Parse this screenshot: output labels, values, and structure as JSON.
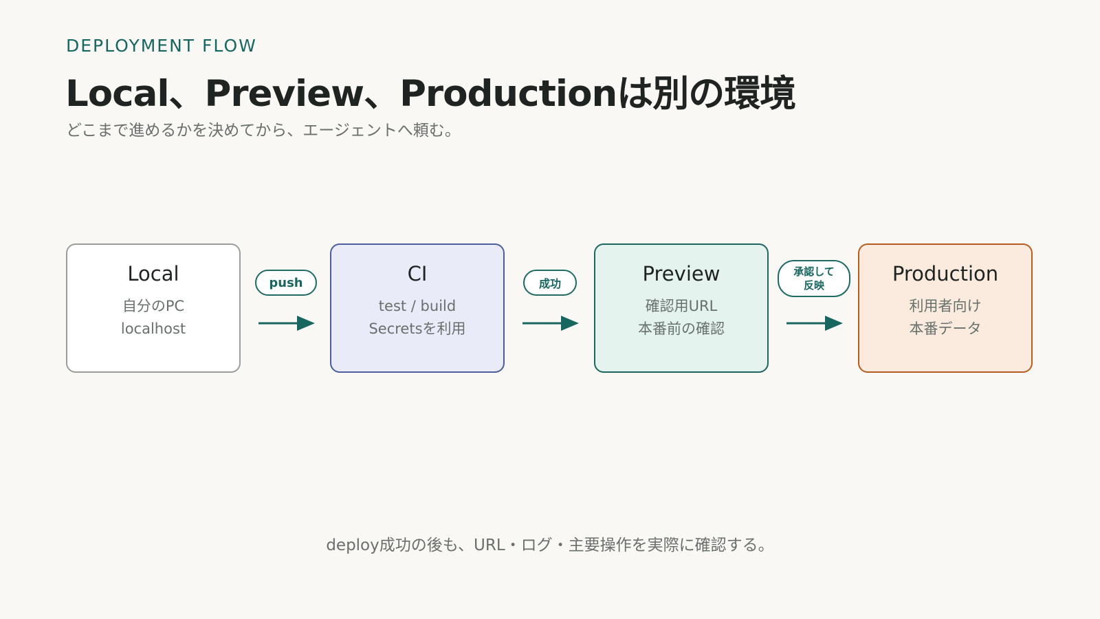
{
  "header": {
    "eyebrow": "DEPLOYMENT FLOW",
    "title": "Local、Preview、Productionは別の環境",
    "subtitle": "どこまで進めるかを決めてから、エージェントへ頼む。"
  },
  "stages": [
    {
      "title": "Local",
      "lines": [
        "自分のPC",
        "localhost"
      ],
      "fill": "#ffffff",
      "border": "#9a9d9b"
    },
    {
      "title": "CI",
      "lines": [
        "test / build",
        "Secretsを利用"
      ],
      "fill": "#e9ebf8",
      "border": "#4b5d9c"
    },
    {
      "title": "Preview",
      "lines": [
        "確認用URL",
        "本番前の確認"
      ],
      "fill": "#e5f3ef",
      "border": "#1e655d"
    },
    {
      "title": "Production",
      "lines": [
        "利用者向け",
        "本番データ"
      ],
      "fill": "#faebde",
      "border": "#b85d22"
    }
  ],
  "transitions": [
    {
      "label": "push",
      "arrow_icon": "arrow-right-icon"
    },
    {
      "label": "成功",
      "arrow_icon": "arrow-right-icon"
    },
    {
      "label": "承認して\n反映",
      "arrow_icon": "arrow-right-icon"
    }
  ],
  "footer": "deploy成功の後も、URL・ログ・主要操作を実際に確認する。",
  "colors": {
    "accent": "#17665f",
    "background": "#faf8f4",
    "text": "#1f2321",
    "muted_text": "#6a6f6c"
  }
}
